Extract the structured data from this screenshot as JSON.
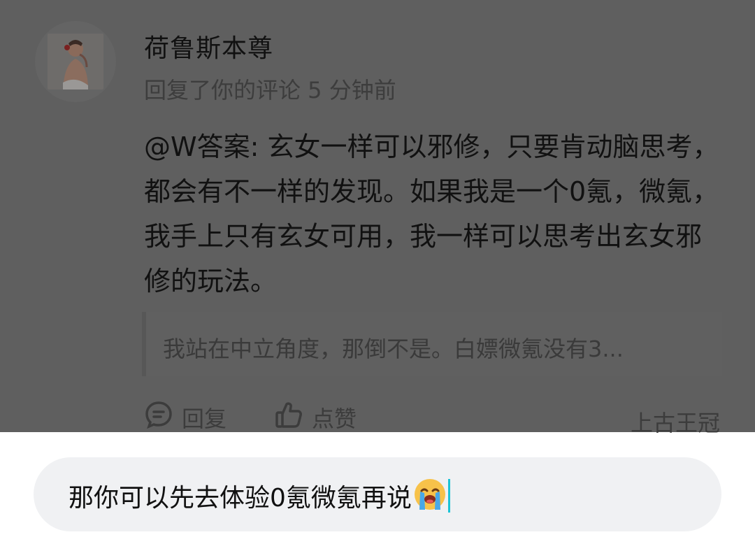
{
  "comment": {
    "username": "荷鲁斯本尊",
    "meta": "回复了你的评论 5 分钟前",
    "body": "@W答案: 玄女一样可以邪修，只要肯动脑思考，都会有不一样的发现。如果我是一个0氪，微氪，我手上只有玄女可用，我一样可以思考出玄女邪修的玩法。",
    "quoted": "我站在中立角度，那倒不是。白嫖微氪没有3...",
    "actions": {
      "reply_label": "回复",
      "like_label": "点赞",
      "badge": "上古王冠"
    }
  },
  "input": {
    "value": "那你可以先去体验0氪微氪再说",
    "emoji": "loudly-crying-face-emoji"
  },
  "colors": {
    "overlay": "#5f5f5f",
    "input_bg": "#f0f1f3",
    "caret": "#1bc3d6"
  }
}
